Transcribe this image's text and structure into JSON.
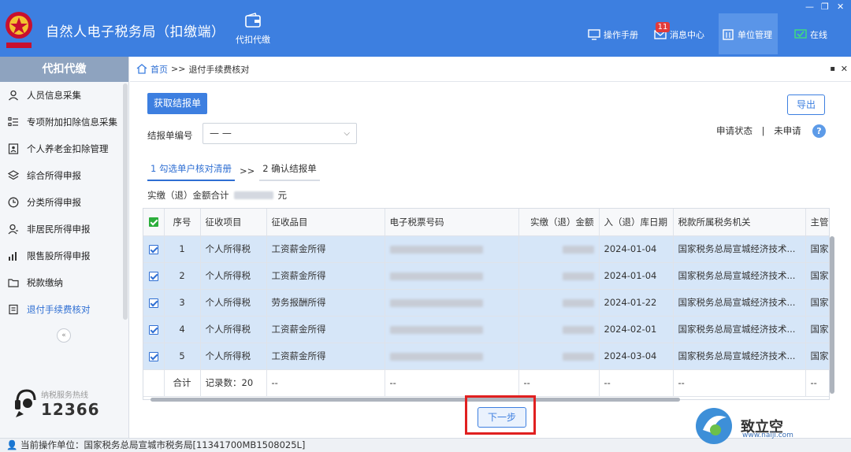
{
  "header": {
    "title": "自然人电子税务局（扣缴端）",
    "center_nav": "代扣代缴",
    "items": [
      {
        "label": "操作手册",
        "icon": "monitor-icon"
      },
      {
        "label": "消息中心",
        "icon": "mail-icon",
        "badge": "11"
      },
      {
        "label": "单位管理",
        "icon": "building-icon"
      },
      {
        "label": "在线",
        "icon": "online-icon"
      }
    ],
    "accent": "#3d7fe0"
  },
  "sidebar": {
    "title": "代扣代缴",
    "items": [
      {
        "label": "人员信息采集"
      },
      {
        "label": "专项附加扣除信息采集"
      },
      {
        "label": "个人养老金扣除管理"
      },
      {
        "label": "综合所得申报"
      },
      {
        "label": "分类所得申报"
      },
      {
        "label": "非居民所得申报"
      },
      {
        "label": "限售股所得申报"
      },
      {
        "label": "税款缴纳"
      },
      {
        "label": "退付手续费核对"
      }
    ],
    "hotline_label": "纳税服务热线",
    "hotline_number": "12366"
  },
  "breadcrumb": {
    "home": "首页",
    "sep": ">>",
    "current": "退付手续费核对"
  },
  "toolbar": {
    "fetch_label": "获取结报单",
    "export_label": "导出",
    "report_label": "结报单编号",
    "report_value": "— —",
    "status_label": "申请状态",
    "status_sep": "|",
    "status_value": "未申请"
  },
  "steps": [
    {
      "label": "1 勾选单户核对清册"
    },
    {
      "label": "2 确认结报单"
    }
  ],
  "step_sep": ">>",
  "total": {
    "label": "实缴（退）金额合计",
    "unit": "元"
  },
  "table": {
    "headers": [
      "序号",
      "征收项目",
      "征收品目",
      "电子税票号码",
      "实缴（退）金额",
      "入（退）库日期",
      "税款所属税务机关",
      "主管"
    ],
    "rows": [
      {
        "no": "1",
        "item": "个人所得税",
        "category": "工资薪金所得",
        "date": "2024-01-04",
        "office": "国家税务总局宣城经济技术...",
        "main": "国家"
      },
      {
        "no": "2",
        "item": "个人所得税",
        "category": "工资薪金所得",
        "date": "2024-01-04",
        "office": "国家税务总局宣城经济技术...",
        "main": "国家"
      },
      {
        "no": "3",
        "item": "个人所得税",
        "category": "劳务报酬所得",
        "date": "2024-01-22",
        "office": "国家税务总局宣城经济技术...",
        "main": "国家"
      },
      {
        "no": "4",
        "item": "个人所得税",
        "category": "工资薪金所得",
        "date": "2024-02-01",
        "office": "国家税务总局宣城经济技术...",
        "main": "国家"
      },
      {
        "no": "5",
        "item": "个人所得税",
        "category": "工资薪金所得",
        "date": "2024-03-04",
        "office": "国家税务总局宣城经济技术...",
        "main": "国家"
      }
    ],
    "footer": {
      "label": "合计",
      "count": "记录数：20",
      "dash": "--"
    }
  },
  "next_label": "下一步",
  "statusbar": "当前操作单位：国家税务总局宣城市税务局[11341700MB1508025L]",
  "watermark": {
    "text": "致立空",
    "url": "www.naiji.com"
  }
}
